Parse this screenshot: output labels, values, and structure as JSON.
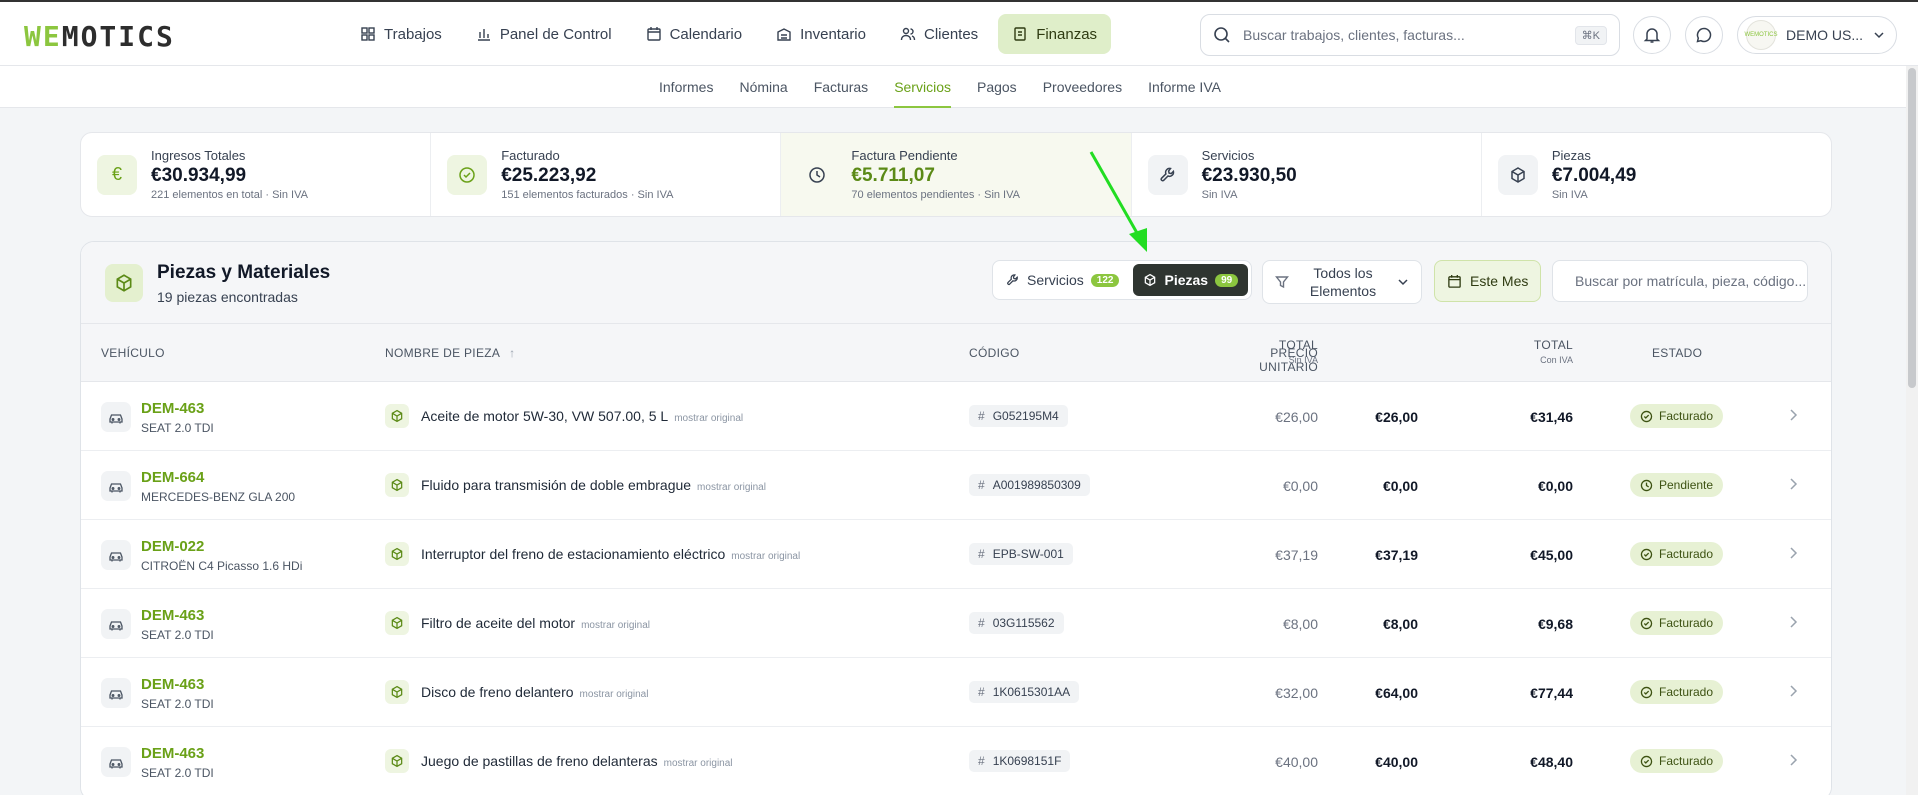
{
  "brand": {
    "logo_a": "WE",
    "logo_b": "MOTICS"
  },
  "nav": [
    {
      "label": "Trabajos",
      "icon": "grid-icon"
    },
    {
      "label": "Panel de Control",
      "icon": "bar-chart-icon"
    },
    {
      "label": "Calendario",
      "icon": "calendar-icon"
    },
    {
      "label": "Inventario",
      "icon": "archive-icon"
    },
    {
      "label": "Clientes",
      "icon": "users-icon"
    },
    {
      "label": "Finanzas",
      "icon": "invoice-icon"
    }
  ],
  "search": {
    "placeholder": "Buscar trabajos, clientes, facturas...",
    "shortcut": "⌘K"
  },
  "user": {
    "name": "DEMO US...",
    "avatar_text": "WEMOTICS"
  },
  "subnav": [
    "Informes",
    "Nómina",
    "Facturas",
    "Servicios",
    "Pagos",
    "Proveedores",
    "Informe IVA"
  ],
  "stats": [
    {
      "label": "Ingresos Totales",
      "value": "€30.934,99",
      "sub": "221 elementos en total · Sin IVA",
      "icon": "euro-icon"
    },
    {
      "label": "Facturado",
      "value": "€25.223,92",
      "sub": "151 elementos facturados · Sin IVA",
      "icon": "check-circle-icon"
    },
    {
      "label": "Factura Pendiente",
      "value": "€5.711,07",
      "sub": "70 elementos pendientes · Sin IVA",
      "icon": "clock-icon"
    },
    {
      "label": "Servicios",
      "value": "€23.930,50",
      "sub": "Sin IVA",
      "icon": "wrench-icon"
    },
    {
      "label": "Piezas",
      "value": "€7.004,49",
      "sub": "Sin IVA",
      "icon": "box-icon"
    }
  ],
  "panel": {
    "title": "Piezas y Materiales",
    "subtitle": "19 piezas encontradas",
    "toggle": {
      "servicios": "Servicios",
      "servicios_count": "122",
      "piezas": "Piezas",
      "piezas_count": "99"
    },
    "filter": "Todos los Elementos",
    "period": "Este Mes",
    "search_placeholder": "Buscar por matrícula, pieza, código..."
  },
  "columns": {
    "vehicle": "VEHÍCULO",
    "part": "NOMBRE DE PIEZA",
    "code": "CÓDIGO",
    "unit_price": "PRECIO UNITARIO",
    "total": "TOTAL",
    "sin_iva": "Sin IVA",
    "con_iva": "Con IVA",
    "status": "ESTADO"
  },
  "rows": [
    {
      "plate": "DEM-463",
      "model": "SEAT 2.0 TDI",
      "part": "Aceite de motor 5W-30, VW 507.00, 5 L",
      "orig": "mostrar original",
      "code": "G052195M4",
      "unit": "€26,00",
      "total": "€26,00",
      "total_iva": "€31,46",
      "status": "Facturado"
    },
    {
      "plate": "DEM-664",
      "model": "MERCEDES-BENZ GLA 200",
      "part": "Fluido para transmisión de doble embrague",
      "orig": "mostrar original",
      "code": "A001989850309",
      "unit": "€0,00",
      "total": "€0,00",
      "total_iva": "€0,00",
      "status": "Pendiente"
    },
    {
      "plate": "DEM-022",
      "model": "CITROËN C4 Picasso 1.6 HDi",
      "part": "Interruptor del freno de estacionamiento eléctrico",
      "orig": "mostrar original",
      "code": "EPB-SW-001",
      "unit": "€37,19",
      "total": "€37,19",
      "total_iva": "€45,00",
      "status": "Facturado"
    },
    {
      "plate": "DEM-463",
      "model": "SEAT 2.0 TDI",
      "part": "Filtro de aceite del motor",
      "orig": "mostrar original",
      "code": "03G115562",
      "unit": "€8,00",
      "total": "€8,00",
      "total_iva": "€9,68",
      "status": "Facturado"
    },
    {
      "plate": "DEM-463",
      "model": "SEAT 2.0 TDI",
      "part": "Disco de freno delantero",
      "orig": "mostrar original",
      "code": "1K0615301AA",
      "unit": "€32,00",
      "total": "€64,00",
      "total_iva": "€77,44",
      "status": "Facturado"
    },
    {
      "plate": "DEM-463",
      "model": "SEAT 2.0 TDI",
      "part": "Juego de pastillas de freno delanteras",
      "orig": "mostrar original",
      "code": "1K0698151F",
      "unit": "€40,00",
      "total": "€40,00",
      "total_iva": "€48,40",
      "status": "Facturado"
    }
  ],
  "colors": {
    "accent": "#8cc63f",
    "accent_dark": "#6aa118",
    "arrow": "#22dd22"
  }
}
